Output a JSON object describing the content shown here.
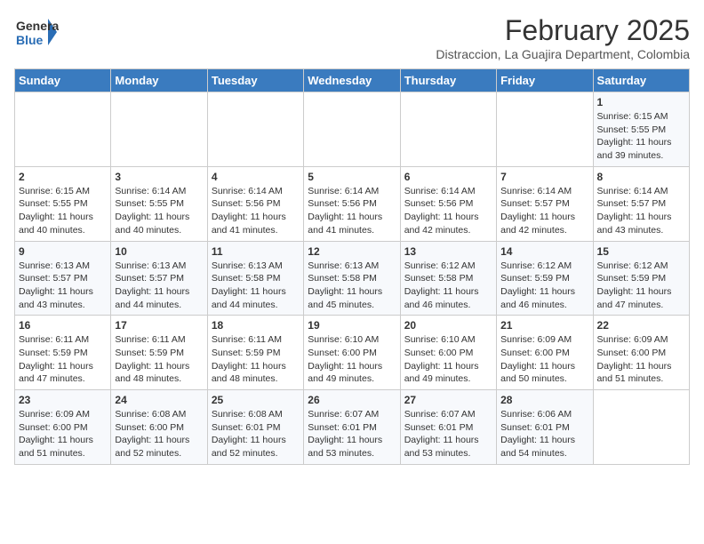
{
  "logo": {
    "general": "General",
    "blue": "Blue"
  },
  "title": {
    "month_year": "February 2025",
    "location": "Distraccion, La Guajira Department, Colombia"
  },
  "weekdays": [
    "Sunday",
    "Monday",
    "Tuesday",
    "Wednesday",
    "Thursday",
    "Friday",
    "Saturday"
  ],
  "weeks": [
    [
      {
        "day": "",
        "info": ""
      },
      {
        "day": "",
        "info": ""
      },
      {
        "day": "",
        "info": ""
      },
      {
        "day": "",
        "info": ""
      },
      {
        "day": "",
        "info": ""
      },
      {
        "day": "",
        "info": ""
      },
      {
        "day": "1",
        "info": "Sunrise: 6:15 AM\nSunset: 5:55 PM\nDaylight: 11 hours and 39 minutes."
      }
    ],
    [
      {
        "day": "2",
        "info": "Sunrise: 6:15 AM\nSunset: 5:55 PM\nDaylight: 11 hours and 40 minutes."
      },
      {
        "day": "3",
        "info": "Sunrise: 6:14 AM\nSunset: 5:55 PM\nDaylight: 11 hours and 40 minutes."
      },
      {
        "day": "4",
        "info": "Sunrise: 6:14 AM\nSunset: 5:56 PM\nDaylight: 11 hours and 41 minutes."
      },
      {
        "day": "5",
        "info": "Sunrise: 6:14 AM\nSunset: 5:56 PM\nDaylight: 11 hours and 41 minutes."
      },
      {
        "day": "6",
        "info": "Sunrise: 6:14 AM\nSunset: 5:56 PM\nDaylight: 11 hours and 42 minutes."
      },
      {
        "day": "7",
        "info": "Sunrise: 6:14 AM\nSunset: 5:57 PM\nDaylight: 11 hours and 42 minutes."
      },
      {
        "day": "8",
        "info": "Sunrise: 6:14 AM\nSunset: 5:57 PM\nDaylight: 11 hours and 43 minutes."
      }
    ],
    [
      {
        "day": "9",
        "info": "Sunrise: 6:13 AM\nSunset: 5:57 PM\nDaylight: 11 hours and 43 minutes."
      },
      {
        "day": "10",
        "info": "Sunrise: 6:13 AM\nSunset: 5:57 PM\nDaylight: 11 hours and 44 minutes."
      },
      {
        "day": "11",
        "info": "Sunrise: 6:13 AM\nSunset: 5:58 PM\nDaylight: 11 hours and 44 minutes."
      },
      {
        "day": "12",
        "info": "Sunrise: 6:13 AM\nSunset: 5:58 PM\nDaylight: 11 hours and 45 minutes."
      },
      {
        "day": "13",
        "info": "Sunrise: 6:12 AM\nSunset: 5:58 PM\nDaylight: 11 hours and 46 minutes."
      },
      {
        "day": "14",
        "info": "Sunrise: 6:12 AM\nSunset: 5:59 PM\nDaylight: 11 hours and 46 minutes."
      },
      {
        "day": "15",
        "info": "Sunrise: 6:12 AM\nSunset: 5:59 PM\nDaylight: 11 hours and 47 minutes."
      }
    ],
    [
      {
        "day": "16",
        "info": "Sunrise: 6:11 AM\nSunset: 5:59 PM\nDaylight: 11 hours and 47 minutes."
      },
      {
        "day": "17",
        "info": "Sunrise: 6:11 AM\nSunset: 5:59 PM\nDaylight: 11 hours and 48 minutes."
      },
      {
        "day": "18",
        "info": "Sunrise: 6:11 AM\nSunset: 5:59 PM\nDaylight: 11 hours and 48 minutes."
      },
      {
        "day": "19",
        "info": "Sunrise: 6:10 AM\nSunset: 6:00 PM\nDaylight: 11 hours and 49 minutes."
      },
      {
        "day": "20",
        "info": "Sunrise: 6:10 AM\nSunset: 6:00 PM\nDaylight: 11 hours and 49 minutes."
      },
      {
        "day": "21",
        "info": "Sunrise: 6:09 AM\nSunset: 6:00 PM\nDaylight: 11 hours and 50 minutes."
      },
      {
        "day": "22",
        "info": "Sunrise: 6:09 AM\nSunset: 6:00 PM\nDaylight: 11 hours and 51 minutes."
      }
    ],
    [
      {
        "day": "23",
        "info": "Sunrise: 6:09 AM\nSunset: 6:00 PM\nDaylight: 11 hours and 51 minutes."
      },
      {
        "day": "24",
        "info": "Sunrise: 6:08 AM\nSunset: 6:00 PM\nDaylight: 11 hours and 52 minutes."
      },
      {
        "day": "25",
        "info": "Sunrise: 6:08 AM\nSunset: 6:01 PM\nDaylight: 11 hours and 52 minutes."
      },
      {
        "day": "26",
        "info": "Sunrise: 6:07 AM\nSunset: 6:01 PM\nDaylight: 11 hours and 53 minutes."
      },
      {
        "day": "27",
        "info": "Sunrise: 6:07 AM\nSunset: 6:01 PM\nDaylight: 11 hours and 53 minutes."
      },
      {
        "day": "28",
        "info": "Sunrise: 6:06 AM\nSunset: 6:01 PM\nDaylight: 11 hours and 54 minutes."
      },
      {
        "day": "",
        "info": ""
      }
    ]
  ]
}
